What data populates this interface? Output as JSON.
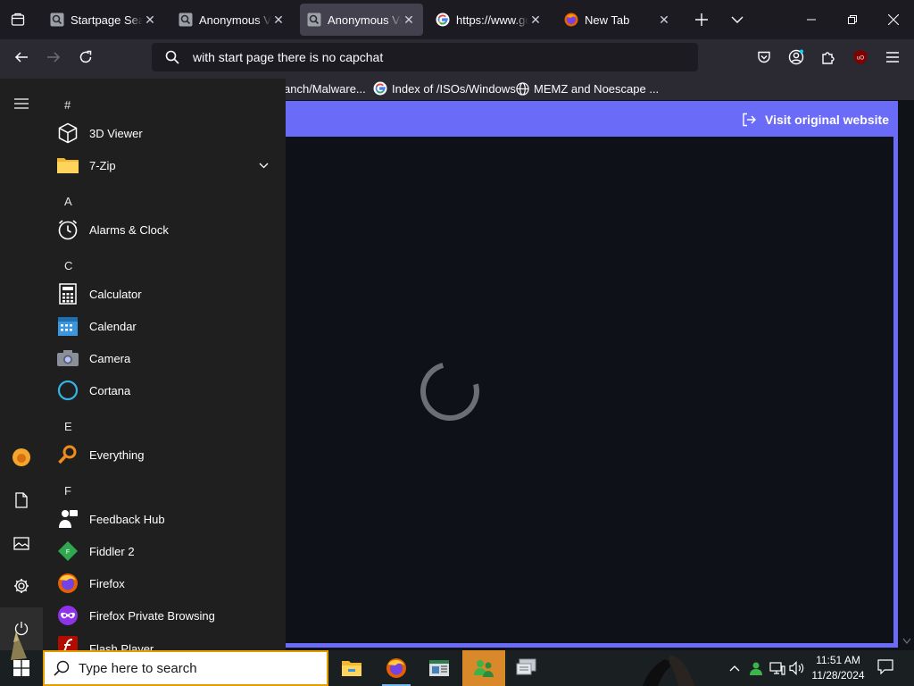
{
  "browser": {
    "tabs": [
      {
        "title": "Startpage Search",
        "icon": "startpage-icon",
        "active": false
      },
      {
        "title": "Anonymous View",
        "icon": "startpage-icon",
        "active": false
      },
      {
        "title": "Anonymous View",
        "icon": "startpage-icon",
        "active": true
      },
      {
        "title": "https://www.google",
        "icon": "google-icon",
        "active": false
      },
      {
        "title": "New Tab",
        "icon": "firefox-icon",
        "active": false
      }
    ],
    "address": "with start page there is no capchat",
    "bookmarks": [
      {
        "label": "anch/Malware..."
      },
      {
        "label": "Index of /ISOs/Windows",
        "icon": "google-icon"
      },
      {
        "label": "MEMZ and Noescape ...",
        "icon": "globe-icon"
      }
    ]
  },
  "page": {
    "visit_label": "Visit original website",
    "accent": "#6a6cf7"
  },
  "start_menu": {
    "sections": [
      {
        "letter": "#",
        "apps": [
          {
            "name": "3D Viewer",
            "icon": "cube-icon"
          },
          {
            "name": "7-Zip",
            "icon": "folder-icon",
            "expandable": true
          }
        ]
      },
      {
        "letter": "A",
        "apps": [
          {
            "name": "Alarms & Clock",
            "icon": "clock-icon"
          }
        ]
      },
      {
        "letter": "C",
        "apps": [
          {
            "name": "Calculator",
            "icon": "calculator-icon"
          },
          {
            "name": "Calendar",
            "icon": "calendar-icon"
          },
          {
            "name": "Camera",
            "icon": "camera-icon"
          },
          {
            "name": "Cortana",
            "icon": "cortana-icon"
          }
        ]
      },
      {
        "letter": "E",
        "apps": [
          {
            "name": "Everything",
            "icon": "magnifier-icon"
          }
        ]
      },
      {
        "letter": "F",
        "apps": [
          {
            "name": "Feedback Hub",
            "icon": "feedback-icon"
          },
          {
            "name": "Fiddler 2",
            "icon": "fiddler-icon"
          },
          {
            "name": "Firefox",
            "icon": "firefox-icon"
          },
          {
            "name": "Firefox Private Browsing",
            "icon": "private-mask-icon"
          },
          {
            "name": "Flash Player",
            "icon": "flash-icon"
          }
        ]
      }
    ]
  },
  "taskbar": {
    "search_placeholder": "Type here to search",
    "time": "11:51 AM",
    "date": "11/28/2024"
  }
}
